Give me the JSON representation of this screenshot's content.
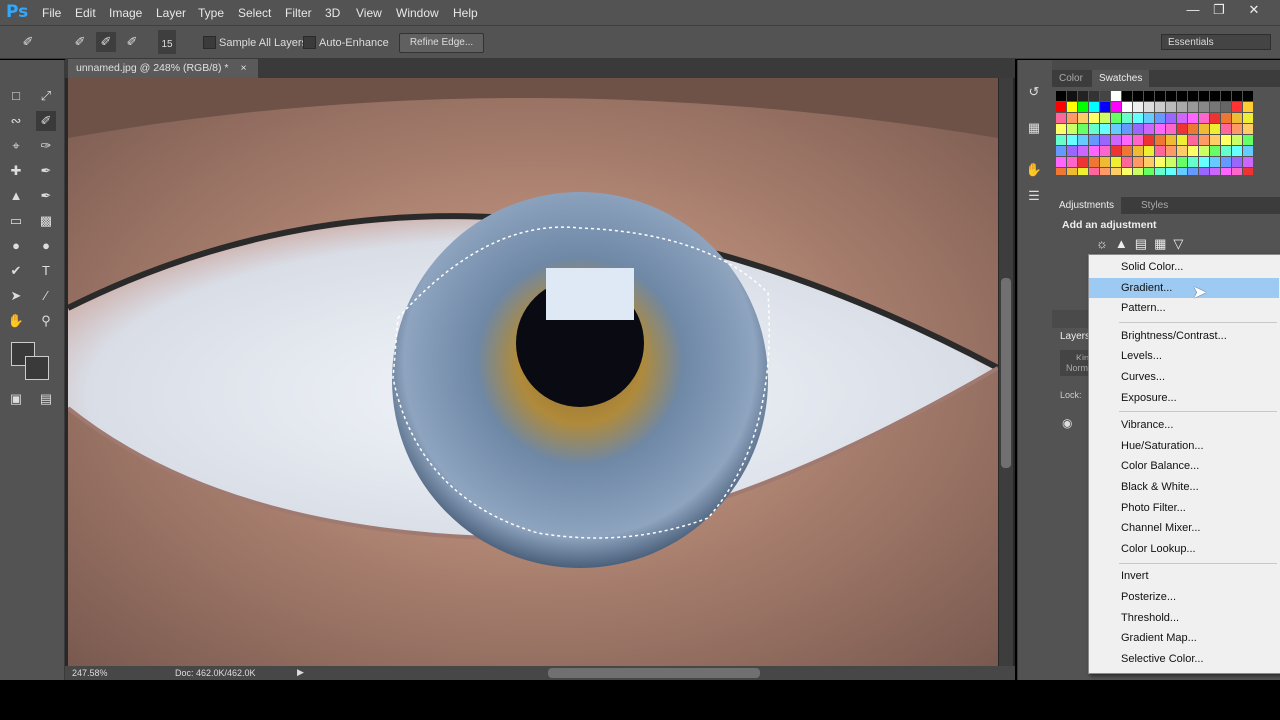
{
  "app": {
    "logo": "Ps"
  },
  "menu": [
    "File",
    "Edit",
    "Image",
    "Layer",
    "Type",
    "Select",
    "Filter",
    "3D",
    "View",
    "Window",
    "Help"
  ],
  "options_bar": {
    "brush_size": "15",
    "sample_all_layers": "Sample All Layers",
    "auto_enhance": "Auto-Enhance",
    "refine_edge": "Refine Edge...",
    "workspace": "Essentials"
  },
  "document": {
    "tab_title": "unnamed.jpg @ 248% (RGB/8) *",
    "zoom": "247.58%",
    "doc_info": "Doc: 462.0K/462.0K"
  },
  "panels": {
    "color_tab": "Color",
    "swatches_tab": "Swatches",
    "adjustments_tab": "Adjustments",
    "styles_tab": "Styles",
    "add_adjustment": "Add an adjustment",
    "layers_tab": "Layers",
    "kind_placeholder": "Kin",
    "normal": "Norm",
    "lock": "Lock:"
  },
  "dropdown": {
    "groups": [
      [
        "Solid Color...",
        "Gradient...",
        "Pattern..."
      ],
      [
        "Brightness/Contrast...",
        "Levels...",
        "Curves...",
        "Exposure..."
      ],
      [
        "Vibrance...",
        "Hue/Saturation...",
        "Color Balance...",
        "Black & White...",
        "Photo Filter...",
        "Channel Mixer...",
        "Color Lookup..."
      ],
      [
        "Invert",
        "Posterize...",
        "Threshold...",
        "Gradient Map...",
        "Selective Color..."
      ]
    ],
    "highlighted": "Gradient..."
  },
  "colors": {
    "highlight": "#9dcaf3",
    "ui_dark": "#535353"
  }
}
